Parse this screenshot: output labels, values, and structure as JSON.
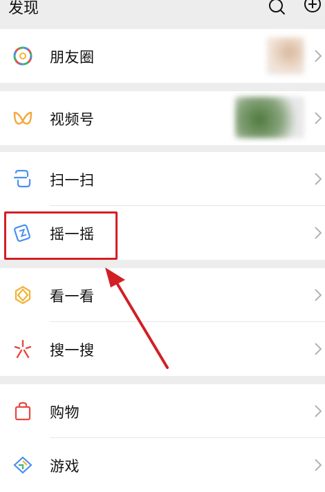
{
  "header": {
    "title": "发现"
  },
  "sections": [
    {
      "items": [
        {
          "label": "朋友圈",
          "icon": "moments-icon"
        }
      ]
    },
    {
      "items": [
        {
          "label": "视频号",
          "icon": "channels-icon"
        }
      ]
    },
    {
      "items": [
        {
          "label": "扫一扫",
          "icon": "scan-icon"
        },
        {
          "label": "摇一摇",
          "icon": "shake-icon"
        }
      ]
    },
    {
      "items": [
        {
          "label": "看一看",
          "icon": "top-stories-icon"
        },
        {
          "label": "搜一搜",
          "icon": "search-sparkle-icon"
        }
      ]
    },
    {
      "items": [
        {
          "label": "购物",
          "icon": "shopping-bag-icon"
        },
        {
          "label": "游戏",
          "icon": "games-icon"
        }
      ]
    }
  ],
  "colors": {
    "highlight": "#d21f26",
    "background": "#ededed"
  }
}
